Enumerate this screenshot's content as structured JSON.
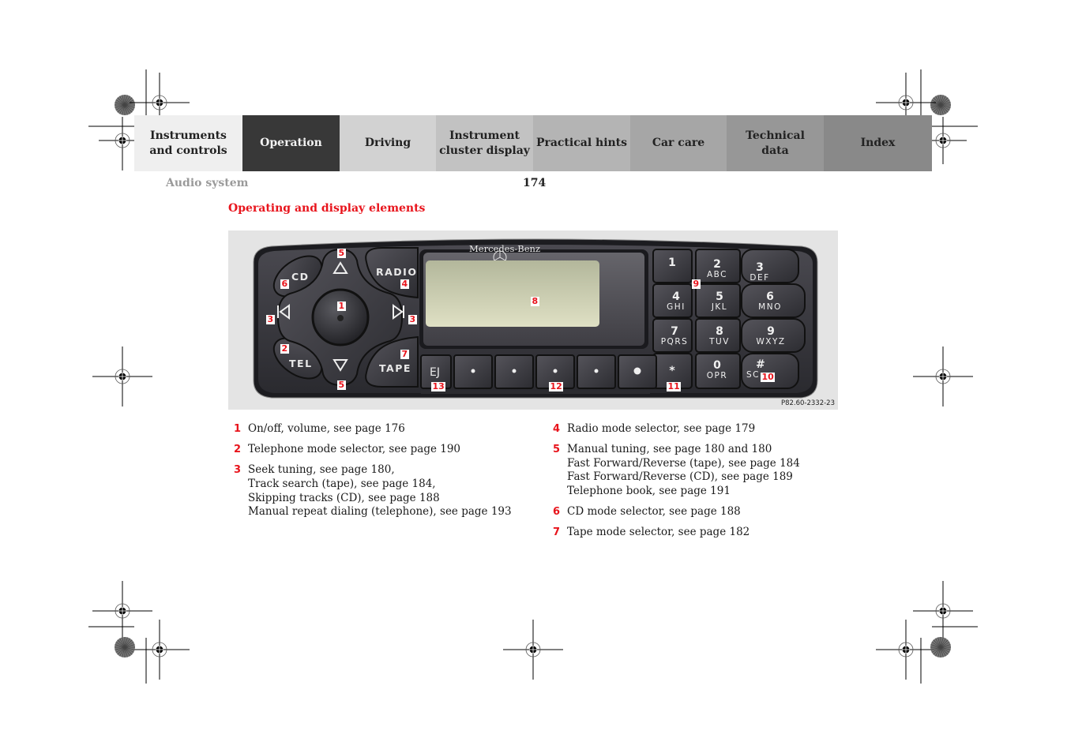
{
  "tabs": [
    {
      "label": "Instruments\nand controls",
      "bg": "#efefef",
      "active": false
    },
    {
      "label": "Operation",
      "bg": "#383838",
      "active": true
    },
    {
      "label": "Driving",
      "bg": "#d2d2d2",
      "active": false
    },
    {
      "label": "Instrument\ncluster display",
      "bg": "#c2c2c2",
      "active": false
    },
    {
      "label": "Practical hints",
      "bg": "#b4b4b4",
      "active": false
    },
    {
      "label": "Car care",
      "bg": "#a6a6a6",
      "active": false
    },
    {
      "label": "Technical\ndata",
      "bg": "#979797",
      "active": false
    },
    {
      "label": "Index",
      "bg": "#898989",
      "active": false
    }
  ],
  "header": {
    "section_title": "Audio system",
    "page_number": "174"
  },
  "heading": "Operating and display elements",
  "figure": {
    "code": "P82.60-2332-23",
    "brand": "Mercedes-Benz",
    "buttons": {
      "cd": "CD",
      "tel": "TEL",
      "radio": "RADIO",
      "tape": "TAPE",
      "eject": "EJ"
    },
    "keypad": [
      {
        "digit": "1",
        "letters": ""
      },
      {
        "digit": "2",
        "letters": "ABC"
      },
      {
        "digit": "3",
        "letters": "DEF"
      },
      {
        "digit": "4",
        "letters": "GHI"
      },
      {
        "digit": "5",
        "letters": "JKL"
      },
      {
        "digit": "6",
        "letters": "MNO"
      },
      {
        "digit": "7",
        "letters": "PQRS"
      },
      {
        "digit": "8",
        "letters": "TUV"
      },
      {
        "digit": "9",
        "letters": "WXYZ"
      },
      {
        "digit": "*",
        "letters": ""
      },
      {
        "digit": "0",
        "letters": "OPR"
      },
      {
        "digit": "#",
        "letters": "SC"
      }
    ],
    "callouts": [
      "1",
      "2",
      "3",
      "3",
      "4",
      "5",
      "5",
      "6",
      "7",
      "8",
      "9",
      "10",
      "11",
      "12",
      "13"
    ]
  },
  "legend_left": [
    {
      "num": "1",
      "lines": [
        "On/off, volume, see page 176"
      ]
    },
    {
      "num": "2",
      "lines": [
        "Telephone mode selector, see page 190"
      ]
    },
    {
      "num": "3",
      "lines": [
        "Seek tuning, see page 180,",
        "Track search (tape), see page 184,",
        "Skipping tracks (CD), see page 188",
        "Manual repeat dialing (telephone), see page 193"
      ]
    }
  ],
  "legend_right": [
    {
      "num": "4",
      "lines": [
        "Radio mode selector, see page 179"
      ]
    },
    {
      "num": "5",
      "lines": [
        "Manual tuning, see page 180 and 180",
        "Fast Forward/Reverse (tape), see page 184",
        "Fast Forward/Reverse (CD), see page 189",
        "Telephone book, see page 191"
      ]
    },
    {
      "num": "6",
      "lines": [
        "CD mode selector, see page 188"
      ]
    },
    {
      "num": "7",
      "lines": [
        "Tape mode selector, see page 182"
      ]
    }
  ],
  "colors": {
    "accent_red": "#e8141c",
    "section_gray": "#9a9a9a"
  }
}
